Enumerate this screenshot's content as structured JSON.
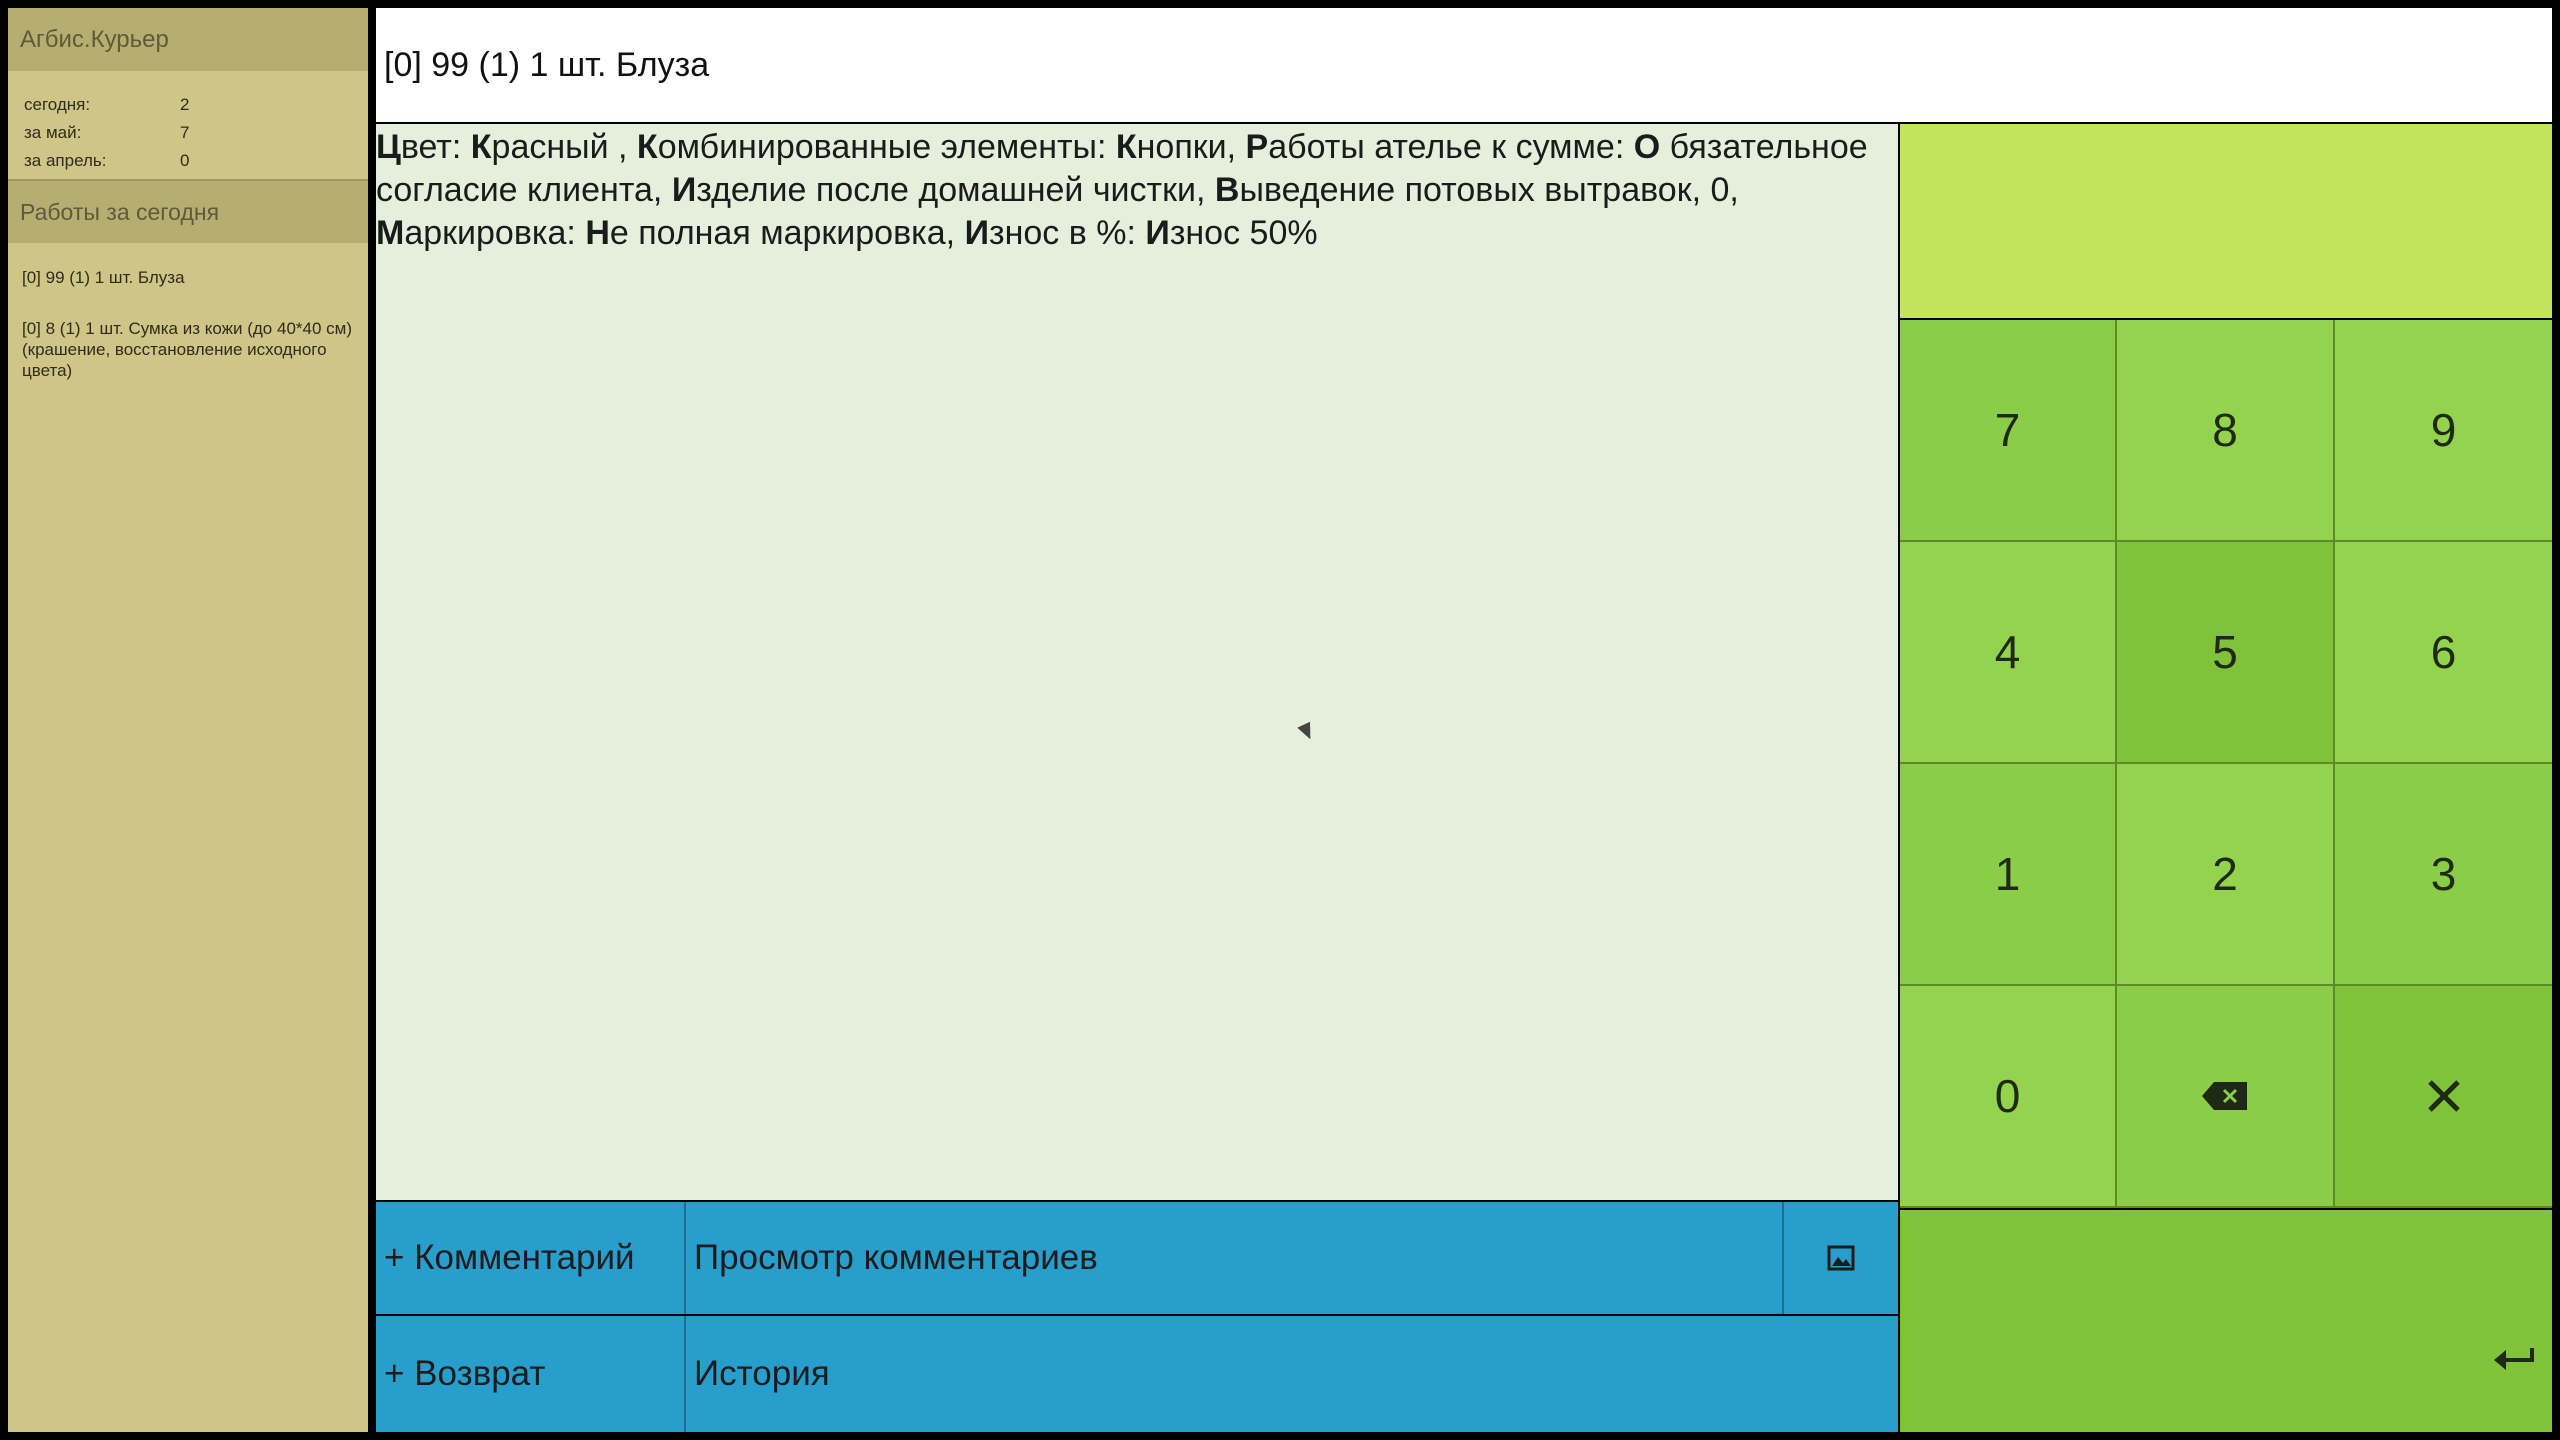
{
  "sidebar": {
    "app_title": "Агбис.Курьер",
    "stats": [
      {
        "label": "сегодня:",
        "value": "2"
      },
      {
        "label": "за май:",
        "value": "7"
      },
      {
        "label": "за апрель:",
        "value": "0"
      }
    ],
    "section_title": "Работы за сегодня",
    "works": [
      "[0] 99 (1) 1 шт. Блуза",
      "[0] 8 (1) 1 шт. Сумка из кожи (до 40*40 см) (крашение, восстановление исходного цвета)"
    ]
  },
  "header": {
    "title": "[0] 99 (1) 1 шт. Блуза"
  },
  "description": [
    {
      "b": "Ц",
      "t": "вет: "
    },
    {
      "b": "К",
      "t": "расный , "
    },
    {
      "b": "К",
      "t": "омбинированные элементы: "
    },
    {
      "b": "К",
      "t": "нопки, "
    },
    {
      "b": "Р",
      "t": "аботы ателье к сумме: "
    },
    {
      "b": "О",
      "t": " бязательное согласие клиента, "
    },
    {
      "b": "И",
      "t": "зделие после домашней чистки, "
    },
    {
      "b": "В",
      "t": "ыведение потовых вытравок, 0, "
    },
    {
      "b": "М",
      "t": "аркировка: "
    },
    {
      "b": "Н",
      "t": "е полная маркировка, "
    },
    {
      "b": "И",
      "t": "знос в %: "
    },
    {
      "b": "И",
      "t": "знос 50%"
    }
  ],
  "buttons": {
    "add_comment": "+ Комментарий",
    "view_comments": "Просмотр комментариев",
    "add_return": "+ Возврат",
    "history": "История"
  },
  "keypad": {
    "display_value": "",
    "keys": [
      "7",
      "8",
      "9",
      "4",
      "5",
      "6",
      "1",
      "2",
      "3",
      "0",
      "backspace-icon",
      "clear-icon"
    ],
    "enter_icon": "enter-icon"
  },
  "colors": {
    "sidebar_bg": "#cfc587",
    "content_bg": "#e5f0dc",
    "button_blue": "#289ecd",
    "keypad_green": "#8ccd48",
    "display_green": "#c2e35d"
  }
}
